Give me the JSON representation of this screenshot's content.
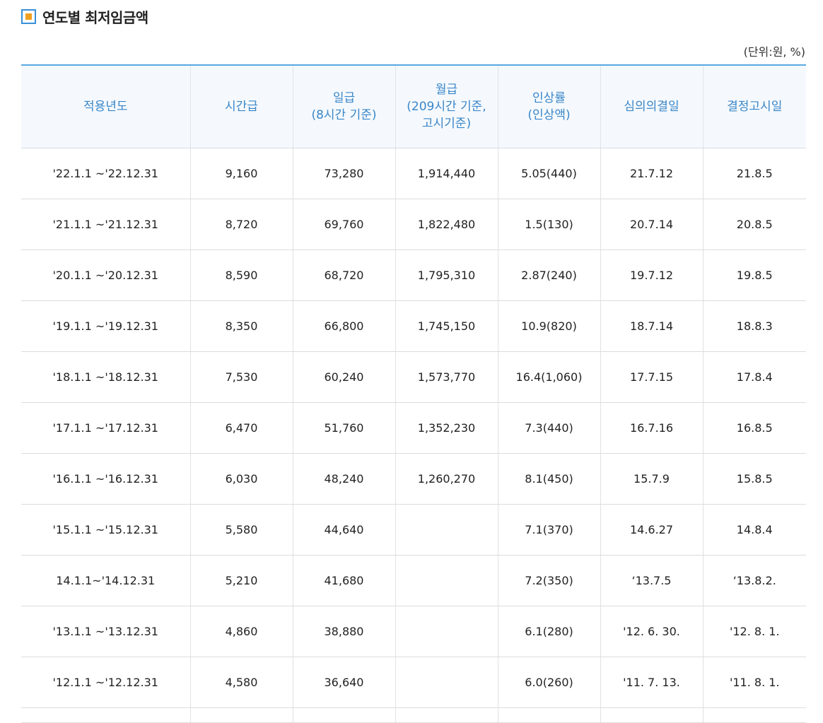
{
  "title": "연도별 최저임금액",
  "unit": "(단위:원, %)",
  "colors": {
    "header_text": "#3a86c8",
    "header_bg": "#f5f9fd",
    "top_border": "#5aa8e0",
    "icon_border": "#3a8fd8",
    "icon_fill": "#f0a020"
  },
  "icons": {
    "title": "square-bullet-icon"
  },
  "table": {
    "headers": [
      "적용년도",
      "시간급",
      "일급\n(8시간 기준)",
      "월급\n(209시간 기준,\n고시기준)",
      "인상률\n(인상액)",
      "심의의결일",
      "결정고시일"
    ],
    "rows": [
      [
        "'22.1.1 ~'22.12.31",
        "9,160",
        "73,280",
        "1,914,440",
        "5.05(440)",
        "21.7.12",
        "21.8.5"
      ],
      [
        "'21.1.1 ~'21.12.31",
        "8,720",
        "69,760",
        "1,822,480",
        "1.5(130)",
        "20.7.14",
        "20.8.5"
      ],
      [
        "'20.1.1 ~'20.12.31",
        "8,590",
        "68,720",
        "1,795,310",
        "2.87(240)",
        "19.7.12",
        "19.8.5"
      ],
      [
        "'19.1.1 ~'19.12.31",
        "8,350",
        "66,800",
        "1,745,150",
        "10.9(820)",
        "18.7.14",
        "18.8.3"
      ],
      [
        "'18.1.1 ~'18.12.31",
        "7,530",
        "60,240",
        "1,573,770",
        "16.4(1,060)",
        "17.7.15",
        "17.8.4"
      ],
      [
        "'17.1.1 ~'17.12.31",
        "6,470",
        "51,760",
        "1,352,230",
        "7.3(440)",
        "16.7.16",
        "16.8.5"
      ],
      [
        "'16.1.1 ~'16.12.31",
        "6,030",
        "48,240",
        "1,260,270",
        "8.1(450)",
        "15.7.9",
        "15.8.5"
      ],
      [
        "'15.1.1 ~'15.12.31",
        "5,580",
        "44,640",
        "",
        "7.1(370)",
        "14.6.27",
        "14.8.4"
      ],
      [
        "14.1.1~'14.12.31",
        "5,210",
        "41,680",
        "",
        "7.2(350)",
        "‘13.7.5",
        "‘13.8.2."
      ],
      [
        "'13.1.1 ~'13.12.31",
        "4,860",
        "38,880",
        "",
        "6.1(280)",
        "'12. 6. 30.",
        "'12. 8. 1."
      ],
      [
        "'12.1.1 ~'12.12.31",
        "4,580",
        "36,640",
        "",
        "6.0(260)",
        "'11. 7. 13.",
        "'11. 8. 1."
      ]
    ]
  }
}
